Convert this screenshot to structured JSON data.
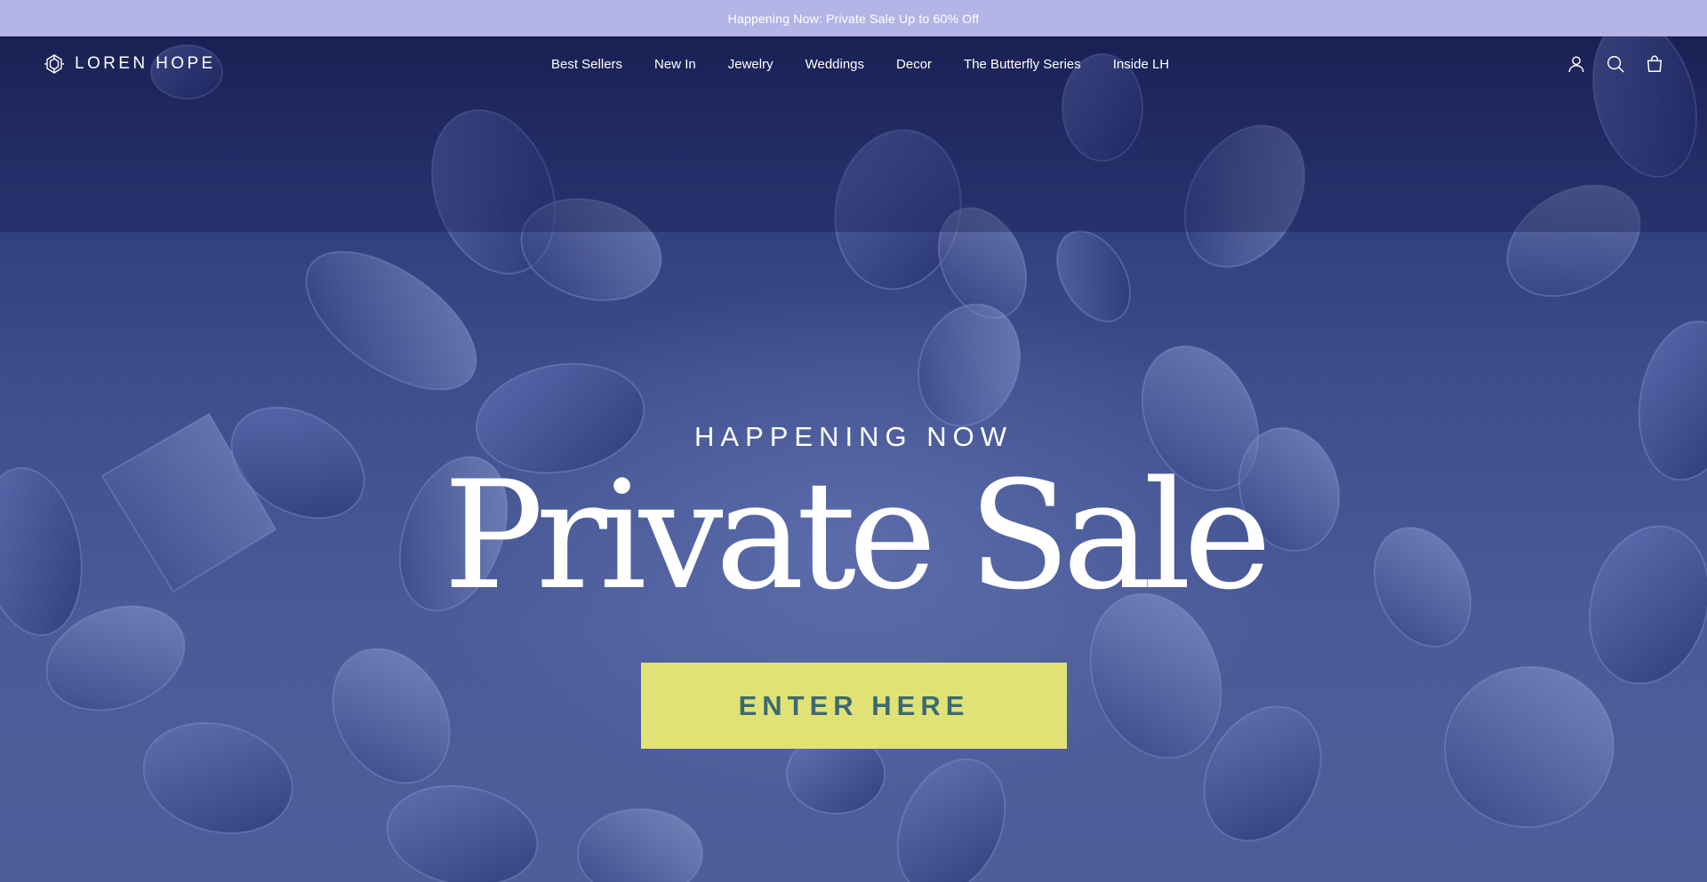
{
  "announcement": {
    "text": "Happening Now: Private Sale Up to 60% Off"
  },
  "header": {
    "logo_text": "LOREN HOPE",
    "nav": [
      {
        "label": "Best Sellers"
      },
      {
        "label": "New In"
      },
      {
        "label": "Jewelry"
      },
      {
        "label": "Weddings"
      },
      {
        "label": "Decor"
      },
      {
        "label": "The Butterfly Series"
      },
      {
        "label": "Inside LH"
      }
    ],
    "icons": [
      "account-icon",
      "search-icon",
      "cart-icon"
    ]
  },
  "hero": {
    "eyebrow": "HAPPENING NOW",
    "headline": "Private Sale",
    "cta_label": "ENTER HERE"
  },
  "colors": {
    "announcement_bg": "#b4b5e6",
    "hero_bg": "#3c4d8c",
    "cta_bg": "#e1e276",
    "cta_text": "#3b6a70",
    "text_light": "#ffffff"
  }
}
